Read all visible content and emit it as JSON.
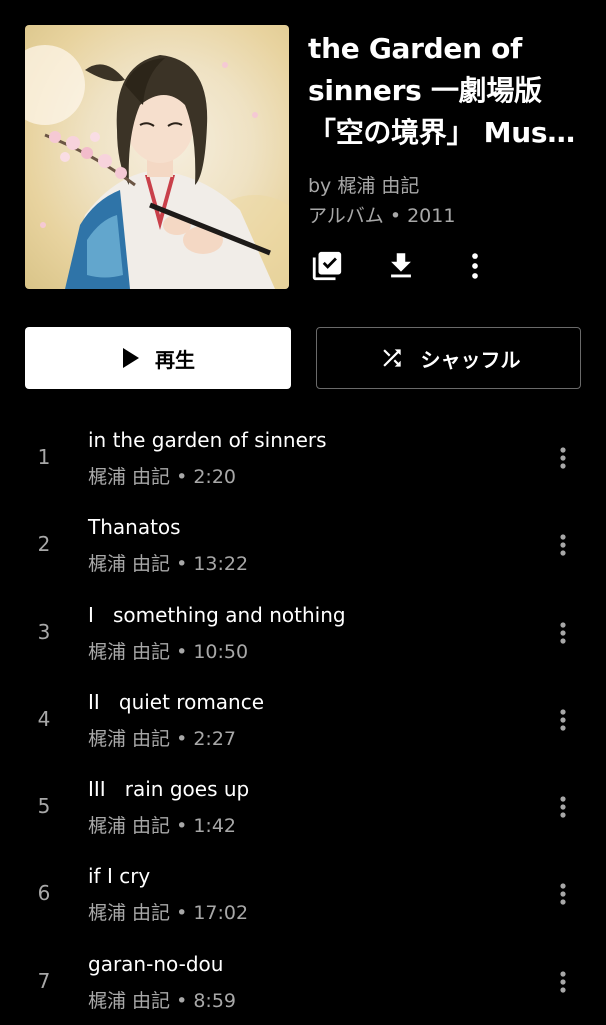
{
  "album": {
    "title": "the Garden of sinners 一劇場版「空の境界」 Music Collection",
    "artist": "by 梶浦 由記",
    "meta": "アルバム • 2011"
  },
  "actions": {
    "save_icon": "library-add-check-icon",
    "download_icon": "download-icon",
    "more_icon": "more-vert-icon"
  },
  "buttons": {
    "play_label": "再生",
    "shuffle_label": "シャッフル"
  },
  "tracks": [
    {
      "num": "1",
      "title": "in the garden of sinners",
      "subtitle": "梶浦 由記 • 2:20"
    },
    {
      "num": "2",
      "title": "Thanatos",
      "subtitle": "梶浦 由記 • 13:22"
    },
    {
      "num": "3",
      "title": "I   something and nothing",
      "subtitle": "梶浦 由記 • 10:50"
    },
    {
      "num": "4",
      "title": "II   quiet romance",
      "subtitle": "梶浦 由記 • 2:27"
    },
    {
      "num": "5",
      "title": "III   rain goes up",
      "subtitle": "梶浦 由記 • 1:42"
    },
    {
      "num": "6",
      "title": "if I cry",
      "subtitle": "梶浦 由記 • 17:02"
    },
    {
      "num": "7",
      "title": "garan-no-dou",
      "subtitle": "梶浦 由記 • 8:59"
    }
  ]
}
